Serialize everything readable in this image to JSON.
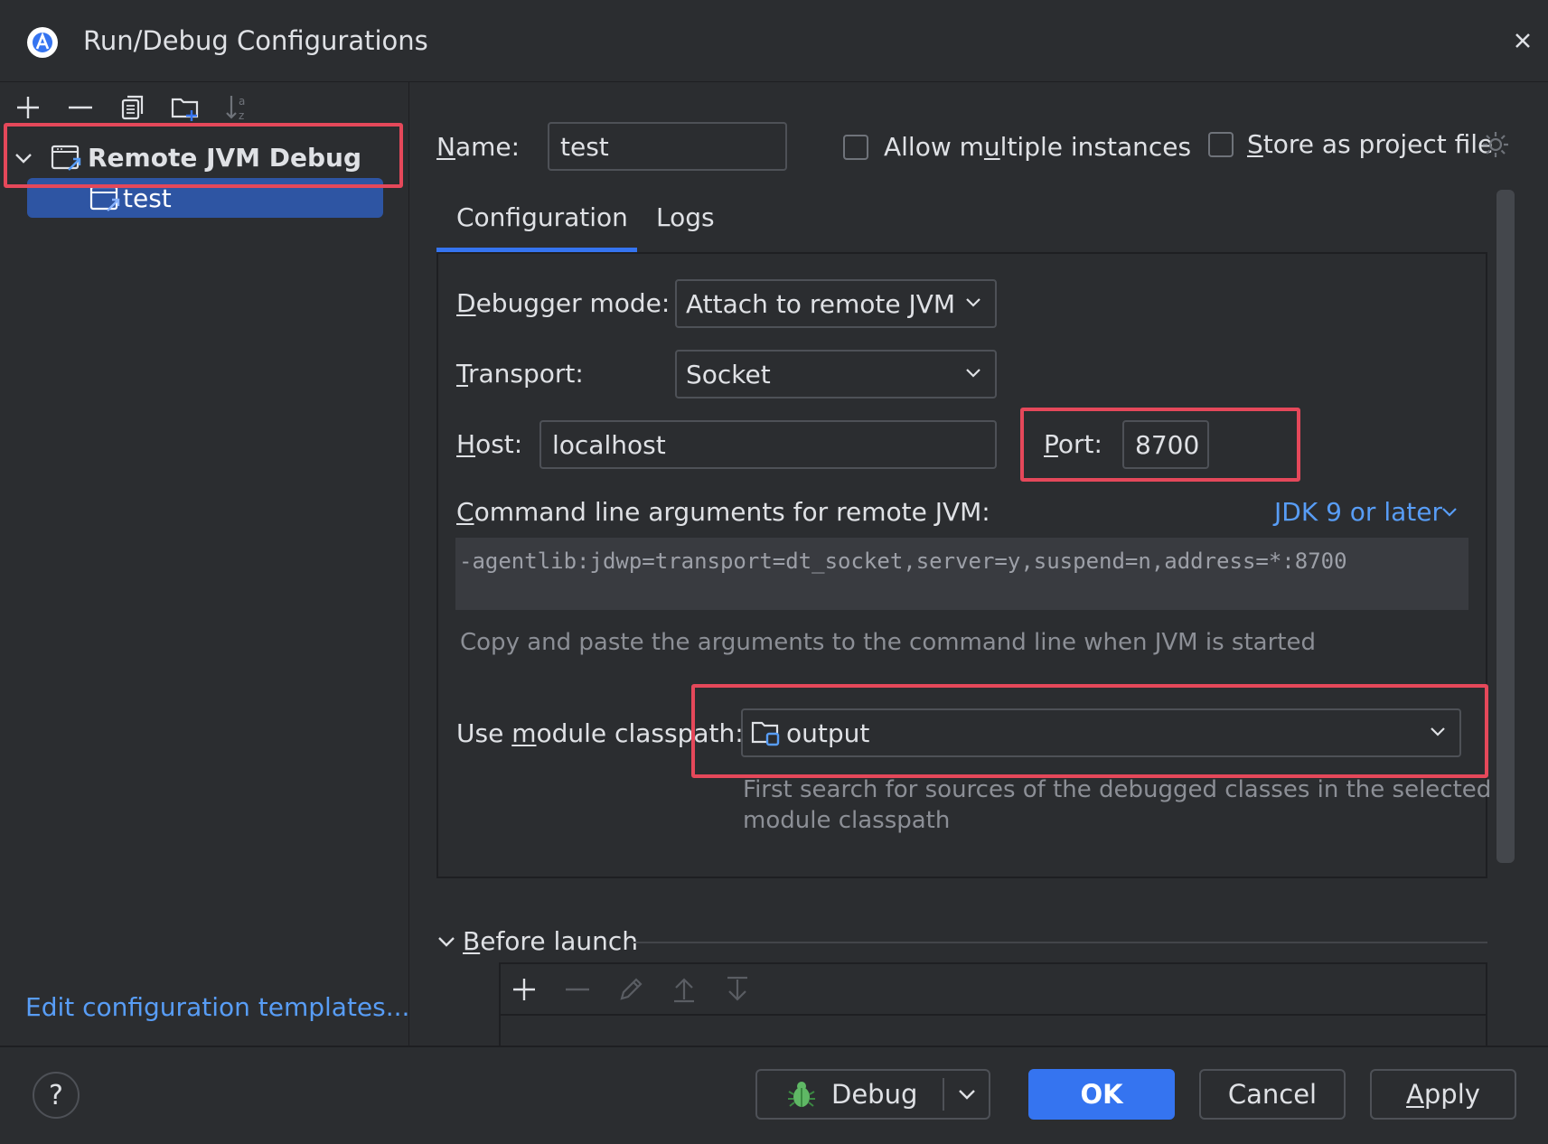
{
  "window": {
    "title": "Run/Debug Configurations"
  },
  "sidebar": {
    "tree": {
      "group_label": "Remote JVM Debug",
      "item_label": "test"
    },
    "edit_templates_link": "Edit configuration templates..."
  },
  "form": {
    "name_label_first": "N",
    "name_label_rest": "ame:",
    "name_value": "test",
    "allow_multiple_pre": "Allow m",
    "allow_multiple_u": "u",
    "allow_multiple_post": "ltiple instances",
    "store_project_u": "S",
    "store_project_rest": "tore as project file",
    "tabs": [
      {
        "label": "Configuration",
        "active": true
      },
      {
        "label": "Logs",
        "active": false
      }
    ],
    "debugger_mode_u": "D",
    "debugger_mode_rest": "ebugger mode:",
    "debugger_mode_value": "Attach to remote JVM",
    "transport_u": "T",
    "transport_rest": "ransport:",
    "transport_value": "Socket",
    "host_u": "H",
    "host_rest": "ost:",
    "host_value": "localhost",
    "port_u": "P",
    "port_rest": "ort:",
    "port_value": "8700",
    "cmdline_u": "C",
    "cmdline_rest": "ommand line arguments for remote JVM:",
    "jdk_link": "JDK 9 or later",
    "cmdline_value": "-agentlib:jdwp=transport=dt_socket,server=y,suspend=n,address=*:8700",
    "cmdline_hint": "Copy and paste the arguments to the command line when JVM is started",
    "module_pre": "Use ",
    "module_u": "m",
    "module_post": "odule classpath:",
    "module_value": "output",
    "module_hint_line1": "First search for sources of the debugged classes in the selected",
    "module_hint_line2": "module classpath",
    "before_launch_u": "B",
    "before_launch_rest": "efore launch"
  },
  "footer": {
    "help": "?",
    "debug_label": "Debug",
    "ok_label": "OK",
    "cancel_label": "Cancel",
    "apply_u": "A",
    "apply_rest": "pply"
  },
  "colors": {
    "accent": "#3574f0",
    "highlight_box": "#e5485a",
    "link": "#589df6"
  }
}
